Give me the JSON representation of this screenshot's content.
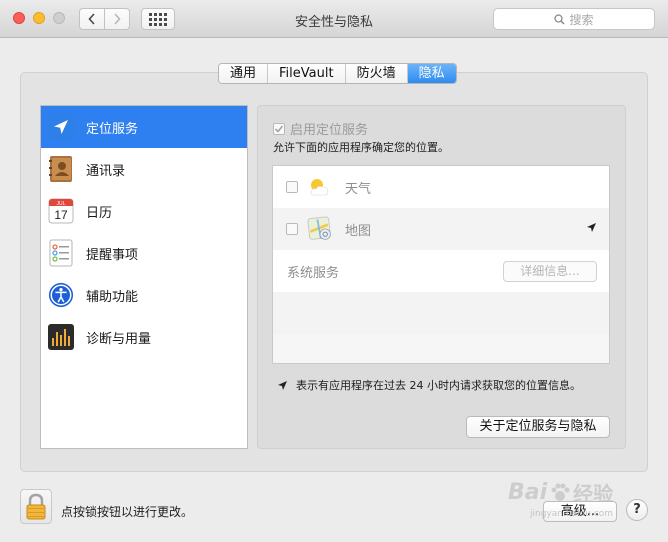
{
  "window": {
    "title": "安全性与隐私"
  },
  "search": {
    "placeholder": "搜索",
    "icon": "magnifier-icon"
  },
  "tabs": [
    {
      "label": "通用",
      "active": false
    },
    {
      "label": "FileVault",
      "active": false
    },
    {
      "label": "防火墙",
      "active": false
    },
    {
      "label": "隐私",
      "active": true
    }
  ],
  "sidebar": {
    "items": [
      {
        "label": "定位服务",
        "icon": "location-arrow-icon",
        "selected": true
      },
      {
        "label": "通讯录",
        "icon": "contacts-book-icon",
        "selected": false
      },
      {
        "label": "日历",
        "icon": "calendar-icon",
        "selected": false
      },
      {
        "label": "提醒事项",
        "icon": "reminders-list-icon",
        "selected": false
      },
      {
        "label": "辅助功能",
        "icon": "accessibility-icon",
        "selected": false
      },
      {
        "label": "诊断与用量",
        "icon": "diagnostics-icon",
        "selected": false
      }
    ],
    "calendar_icon": {
      "month": "JUL",
      "day": "17"
    }
  },
  "location": {
    "enable_label": "启用定位服务",
    "enable_checked": true,
    "description": "允许下面的应用程序确定您的位置。",
    "apps": [
      {
        "name": "天气",
        "icon": "weather-sun-cloud-icon",
        "checked": false,
        "recent_use": false
      },
      {
        "name": "地图",
        "icon": "maps-icon",
        "checked": false,
        "recent_use": true
      }
    ],
    "system_services_label": "系统服务",
    "details_button": "详细信息...",
    "legend_text": "表示有应用程序在过去 24 小时内请求获取您的位置信息。",
    "about_button": "关于定位服务与隐私"
  },
  "footer": {
    "lock_text": "点按锁按钮以进行更改。",
    "advanced_button": "高级...",
    "help_button": "?"
  },
  "watermark": {
    "main_a": "Bai",
    "main_b": "经验",
    "sub": "jingyan.baidu.com"
  },
  "colors": {
    "accent": "#2e7ff0",
    "tab_active": "#3d95f3",
    "close": "#fc5f57",
    "minimize": "#fdbc2e"
  }
}
